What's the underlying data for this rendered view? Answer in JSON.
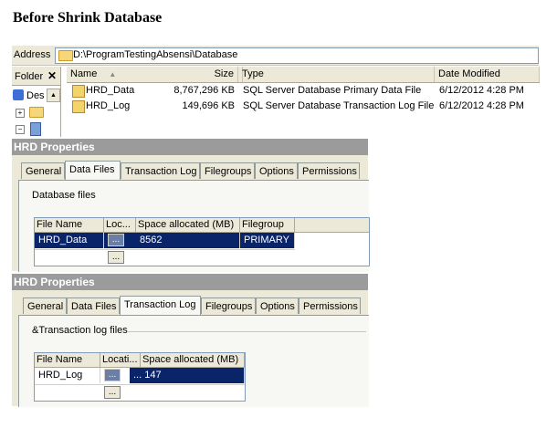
{
  "page_title": "Before Shrink Database",
  "explorer": {
    "address_label": "Address",
    "address_path": "D:\\ProgramTestingAbsensi\\Database",
    "folder_pane": {
      "label": "Folder",
      "close": "✕",
      "tree_item": "Des"
    },
    "columns": [
      "Name",
      "Size",
      "Type",
      "Date Modified"
    ],
    "files": [
      {
        "name": "HRD_Data",
        "size": "8,767,296 KB",
        "type": "SQL Server Database Primary Data File",
        "date": "6/12/2012 4:28 PM"
      },
      {
        "name": "HRD_Log",
        "size": "149,696 KB",
        "type": "SQL Server Database Transaction Log File",
        "date": "6/12/2012 4:28 PM"
      }
    ]
  },
  "dialog1": {
    "title": "HRD Properties",
    "tabs": [
      "General",
      "Data Files",
      "Transaction Log",
      "Filegroups",
      "Options",
      "Permissions"
    ],
    "section": "Database files",
    "columns": [
      "File Name",
      "Loc...",
      "Space allocated (MB)",
      "Filegroup"
    ],
    "rows": [
      {
        "file": "HRD_Data",
        "loc": "...",
        "space": "8562",
        "group": "PRIMARY"
      }
    ],
    "empty_btn": "..."
  },
  "dialog2": {
    "title": "HRD Properties",
    "tabs": [
      "General",
      "Data Files",
      "Transaction Log",
      "Filegroups",
      "Options",
      "Permissions"
    ],
    "section": "&Transaction log files",
    "columns": [
      "File Name",
      "Locati...",
      "Space allocated (MB)"
    ],
    "rows": [
      {
        "file": "HRD_Log",
        "loc": "...",
        "space": "... 147"
      }
    ],
    "empty_btn": "..."
  }
}
